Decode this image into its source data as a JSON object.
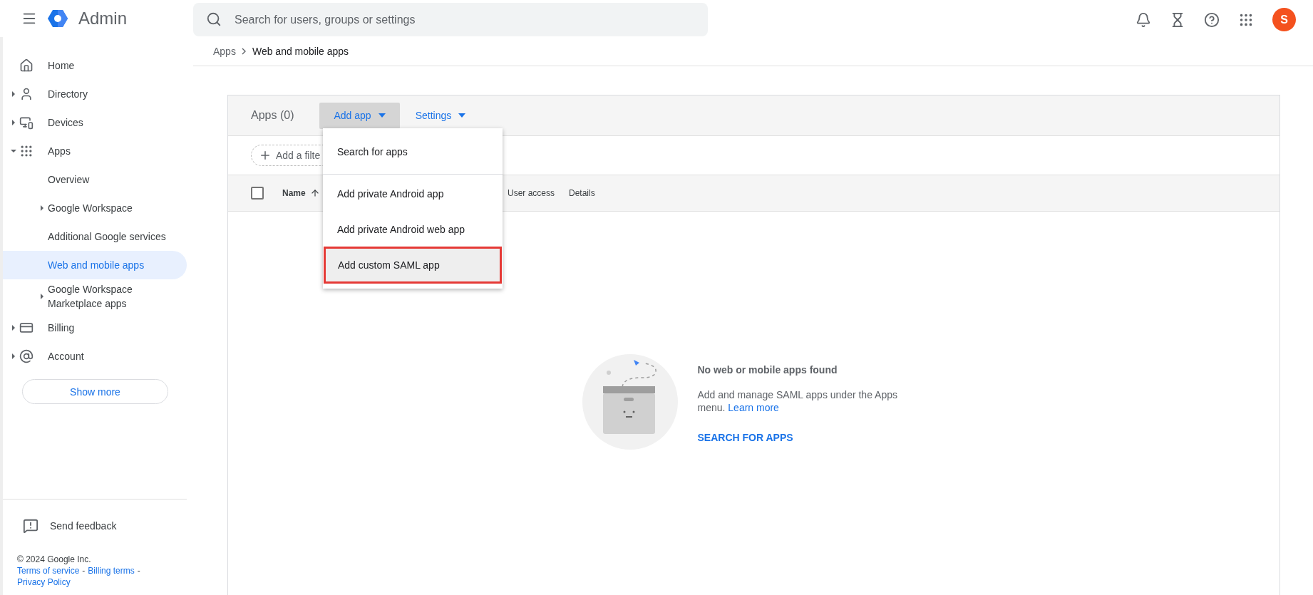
{
  "app": {
    "title": "Admin"
  },
  "search": {
    "placeholder": "Search for users, groups or settings"
  },
  "avatar": {
    "initial": "S"
  },
  "breadcrumb": [
    {
      "label": "Apps",
      "current": false
    },
    {
      "label": "Web and mobile apps",
      "current": true
    }
  ],
  "sidebar": {
    "items": [
      {
        "label": "Home",
        "kind": "link",
        "selected": false
      },
      {
        "label": "Directory",
        "kind": "folder",
        "expanded": false,
        "selected": false
      },
      {
        "label": "Devices",
        "kind": "folder",
        "expanded": false,
        "selected": false
      },
      {
        "label": "Apps",
        "kind": "folder",
        "expanded": true,
        "selected": false,
        "children": [
          {
            "label": "Overview",
            "kind": "link",
            "selected": false
          },
          {
            "label": "Google Workspace",
            "kind": "folder",
            "expanded": false,
            "selected": false
          },
          {
            "label": "Additional Google services",
            "kind": "link",
            "selected": false
          },
          {
            "label": "Web and mobile apps",
            "kind": "link",
            "selected": true
          },
          {
            "label": "Google Workspace Marketplace apps",
            "kind": "folder",
            "expanded": false,
            "selected": false
          }
        ]
      },
      {
        "label": "Billing",
        "kind": "folder",
        "expanded": false,
        "selected": false
      },
      {
        "label": "Account",
        "kind": "folder",
        "expanded": false,
        "selected": false
      }
    ],
    "show_more": "Show more",
    "feedback": "Send feedback",
    "copyright": "© 2024 Google Inc.",
    "links": [
      {
        "label": "Terms of service",
        "separator": "-"
      },
      {
        "label": "Billing terms",
        "separator": "-"
      },
      {
        "label": "Privacy Policy"
      }
    ]
  },
  "panel": {
    "title": "Apps (0)",
    "toolbar": [
      {
        "label": "Add app",
        "selected": true
      },
      {
        "label": "Settings",
        "selected": false
      }
    ],
    "filter": "Add a filte",
    "select_all_checked": false,
    "columns": [
      {
        "label": "Name",
        "sorted": true
      },
      {
        "label": "User access",
        "sorted": false
      },
      {
        "label": "Details",
        "sorted": false
      }
    ],
    "menu": {
      "items": [
        {
          "label": "Search for apps",
          "highlighted": false,
          "divider_after": true
        },
        {
          "label": "Add private Android app",
          "highlighted": false,
          "divider_after": false
        },
        {
          "label": "Add private Android web app",
          "highlighted": false,
          "divider_after": false
        },
        {
          "label": "Add custom SAML app",
          "highlighted": true,
          "divider_after": false
        }
      ]
    },
    "empty": {
      "title": "No web or mobile apps found",
      "text": "Add and manage SAML apps under the Apps menu.",
      "link": "Learn more",
      "action": "SEARCH FOR APPS"
    }
  }
}
